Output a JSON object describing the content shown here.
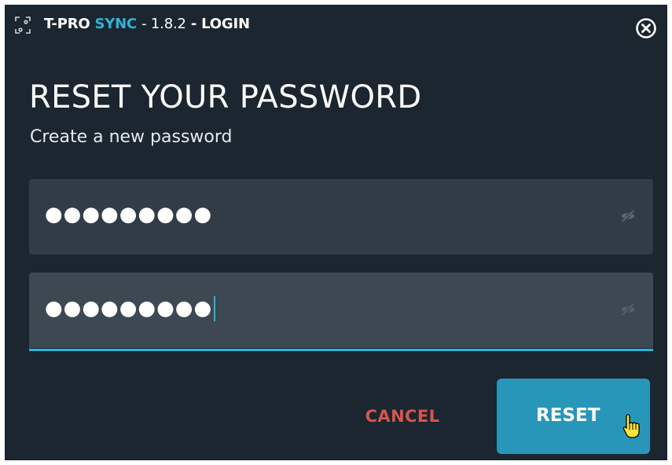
{
  "titlebar": {
    "app_name_part1": "T-PRO",
    "app_name_part2": "SYNC",
    "version": "- 1.8.2",
    "screen": "- LOGIN",
    "close_icon": "close-circle-icon"
  },
  "form": {
    "heading": "RESET YOUR PASSWORD",
    "subheading": "Create a new password",
    "new_password_value": "●●●●●●●●●",
    "confirm_password_value": "●●●●●●●●●",
    "visibility_icon": "eye-slash-icon"
  },
  "actions": {
    "cancel_label": "CANCEL",
    "reset_label": "RESET"
  },
  "colors": {
    "background": "#1b2630",
    "accent": "#2fb3d6",
    "reset_button": "#2896b8",
    "cancel_text": "#d9534f",
    "field_bg": "#313c46"
  }
}
